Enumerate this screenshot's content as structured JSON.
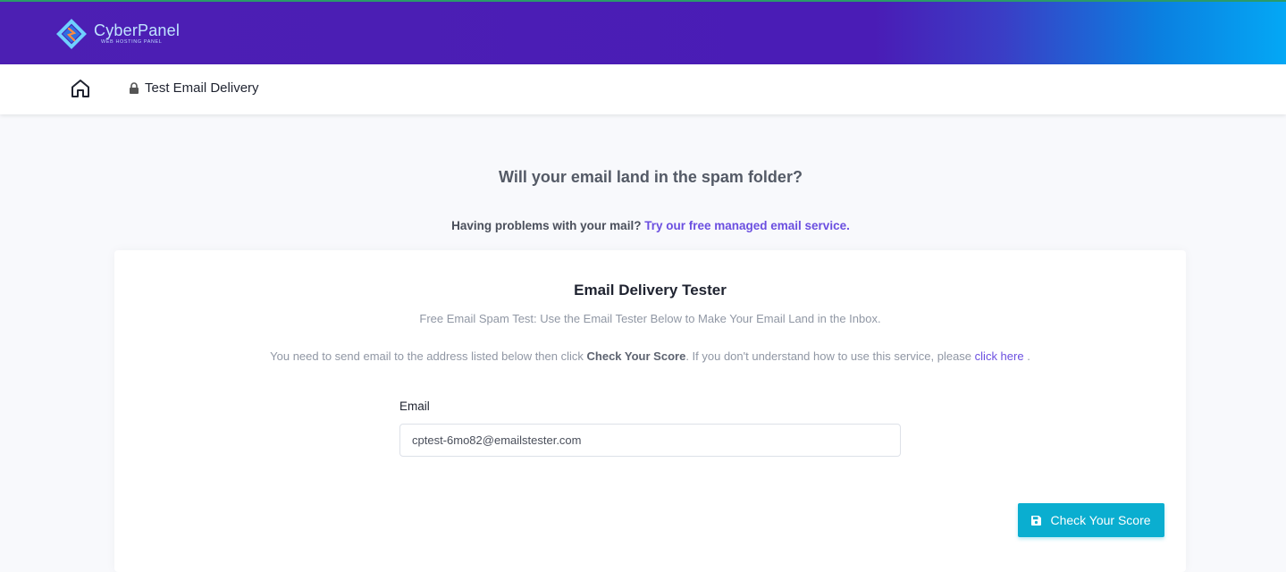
{
  "header": {
    "brand_name": "CyberPanel",
    "brand_tagline": "WEB HOSTING PANEL",
    "logo_icon": "cyberpanel-logo-icon"
  },
  "breadcrumb": {
    "home_icon": "home-icon",
    "page_icon": "lock-icon",
    "page_label": "Test Email Delivery"
  },
  "hero": {
    "title": "Will your email land in the spam folder?",
    "subtitle_prefix": "Having problems with your mail?",
    "subtitle_link": "Try our free managed email service."
  },
  "card": {
    "title": "Email Delivery Tester",
    "description": "Free Email Spam Test: Use the Email Tester Below to Make Your Email Land in the Inbox.",
    "note_prefix": "You need to send email to the address listed below then click",
    "note_bold": "Check Your Score",
    "note_middle": ". If you don't understand how to use this service, please",
    "note_link": "click here",
    "note_suffix": "."
  },
  "form": {
    "email_label": "Email",
    "email_value": "cptest-6mo82@emailstester.com"
  },
  "actions": {
    "score_button_label": "Check Your Score",
    "score_button_icon": "save-icon"
  },
  "colors": {
    "header_start": "#4c1fb3",
    "header_end": "#04a8f5",
    "link": "#6b4fe0",
    "button": "#0aaed0"
  }
}
